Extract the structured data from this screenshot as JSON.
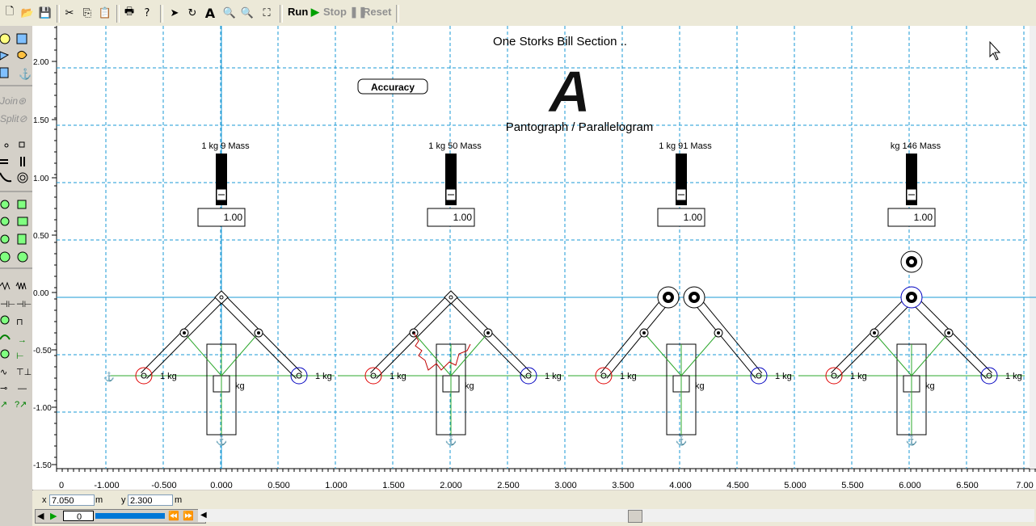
{
  "toolbar": {
    "run": "Run",
    "stop": "Stop",
    "reset": "Reset",
    "run_color": "#00a000",
    "disabled_color": "#909090"
  },
  "left_panel": {
    "join": "Join",
    "split": "Split"
  },
  "canvas": {
    "title": "One Storks Bill Section ..",
    "subtitle": "Pantograph / Parallelogram",
    "logo_letter": "A",
    "accuracy_button": "Accuracy",
    "grid_color": "#1a9ad6",
    "y_ticks": [
      "2.00",
      "1.50",
      "1.00",
      "0.50",
      "0.00",
      "-0.50",
      "-1.00",
      "-1.50"
    ],
    "x_ticks": [
      "0",
      "-1.000",
      "-0.500",
      "0.000",
      "0.500",
      "1.000",
      "1.500",
      "2.000",
      "2.500",
      "3.000",
      "3.500",
      "4.000",
      "4.500",
      "5.000",
      "5.500",
      "6.000",
      "6.500",
      "7.00"
    ],
    "sections": [
      {
        "mass_label": "1 kg 9 Mass",
        "value": "1.00",
        "left_mass": "1 kg",
        "right_mass": "1 kg",
        "center_mass": "kg"
      },
      {
        "mass_label": "1 kg 50 Mass",
        "value": "1.00",
        "left_mass": "1 kg",
        "right_mass": "1 kg",
        "center_mass": "kg"
      },
      {
        "mass_label": "1 kg 91 Mass",
        "value": "1.00",
        "left_mass": "1 kg",
        "right_mass": "1 kg",
        "center_mass": "kg"
      },
      {
        "mass_label": "kg 146 Mass",
        "value": "1.00",
        "left_mass": "1 kg",
        "right_mass": "1 kg",
        "center_mass": "kg"
      }
    ]
  },
  "status": {
    "x_label": "x",
    "x_value": "7.050",
    "x_unit": "m",
    "y_label": "y",
    "y_value": "2.300",
    "y_unit": "m",
    "frame": "0"
  }
}
